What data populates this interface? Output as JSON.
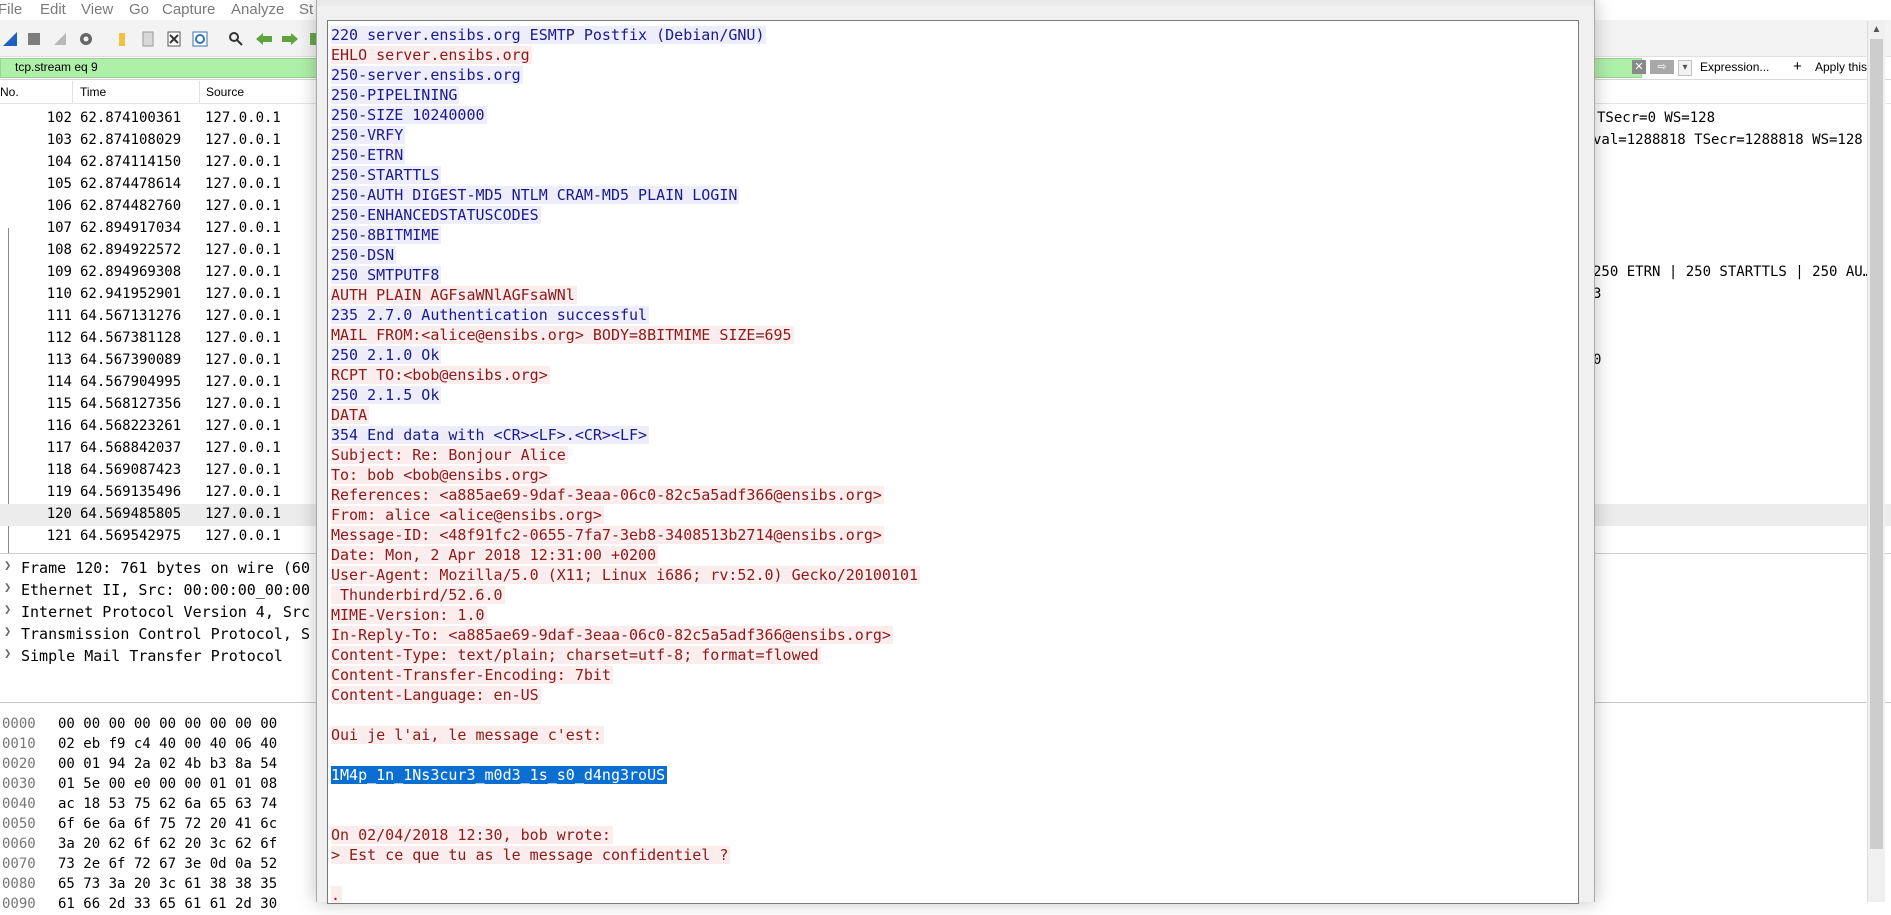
{
  "menu": [
    "File",
    "Edit",
    "View",
    "Go",
    "Capture",
    "Analyze",
    "St"
  ],
  "toolbar_icons": [
    "shark-fin-start-icon",
    "stop-icon",
    "restart-icon",
    "gear-options-icon",
    "open-folder-icon",
    "file-icon",
    "close-file-icon",
    "reload-icon",
    "find-icon",
    "back-arrow-icon",
    "forward-arrow-icon",
    "jump-icon"
  ],
  "filter": {
    "value": "tcp.stream eq 9",
    "expression_label": "Expression...",
    "apply_plus": "+",
    "apply_label": "Apply this filt"
  },
  "columns": [
    "No.",
    "Time",
    "Source"
  ],
  "packets": [
    {
      "no": "102",
      "time": "62.874100361",
      "source": "127.0.0.1"
    },
    {
      "no": "103",
      "time": "62.874108029",
      "source": "127.0.0.1"
    },
    {
      "no": "104",
      "time": "62.874114150",
      "source": "127.0.0.1"
    },
    {
      "no": "105",
      "time": "62.874478614",
      "source": "127.0.0.1"
    },
    {
      "no": "106",
      "time": "62.874482760",
      "source": "127.0.0.1"
    },
    {
      "no": "107",
      "time": "62.894917034",
      "source": "127.0.0.1"
    },
    {
      "no": "108",
      "time": "62.894922572",
      "source": "127.0.0.1"
    },
    {
      "no": "109",
      "time": "62.894969308",
      "source": "127.0.0.1"
    },
    {
      "no": "110",
      "time": "62.941952901",
      "source": "127.0.0.1"
    },
    {
      "no": "111",
      "time": "64.567131276",
      "source": "127.0.0.1"
    },
    {
      "no": "112",
      "time": "64.567381128",
      "source": "127.0.0.1"
    },
    {
      "no": "113",
      "time": "64.567390089",
      "source": "127.0.0.1"
    },
    {
      "no": "114",
      "time": "64.567904995",
      "source": "127.0.0.1"
    },
    {
      "no": "115",
      "time": "64.568127356",
      "source": "127.0.0.1"
    },
    {
      "no": "116",
      "time": "64.568223261",
      "source": "127.0.0.1"
    },
    {
      "no": "117",
      "time": "64.568842037",
      "source": "127.0.0.1"
    },
    {
      "no": "118",
      "time": "64.569087423",
      "source": "127.0.0.1"
    },
    {
      "no": "119",
      "time": "64.569135496",
      "source": "127.0.0.1"
    },
    {
      "no": "120",
      "time": "64.569485805",
      "source": "127.0.0.1",
      "selected": true
    },
    {
      "no": "121",
      "time": "64.569542975",
      "source": "127.0.0.1"
    }
  ],
  "info_fragments": {
    "row102": "TSecr=0 WS=128",
    "row103": "val=1288818 TSecr=1288818 WS=128",
    "row109": "250 ETRN | 250 STARTTLS | 250 AU…",
    "row110": "3",
    "row113": "0"
  },
  "details": [
    "Frame 120: 761 bytes on wire (60",
    "Ethernet II, Src: 00:00:00_00:00",
    "Internet Protocol Version 4, Src",
    "Transmission Control Protocol, S",
    "Simple Mail Transfer Protocol"
  ],
  "hex_rows": [
    {
      "offset": "0000",
      "bytes": "00 00 00 00 00 00 00 00  00"
    },
    {
      "offset": "0010",
      "bytes": "02 eb f9 c4 40 00 40 06  40"
    },
    {
      "offset": "0020",
      "bytes": "00 01 94 2a 02 4b b3 8a  54"
    },
    {
      "offset": "0030",
      "bytes": "01 5e 00 e0 00 00 01 01  08"
    },
    {
      "offset": "0040",
      "bytes": "ac 18 53 75 62 6a 65 63  74"
    },
    {
      "offset": "0050",
      "bytes": "6f 6e 6a 6f 75 72 20 41  6c"
    },
    {
      "offset": "0060",
      "bytes": "3a 20 62 6f 62 20 3c 62  6f"
    },
    {
      "offset": "0070",
      "bytes": "73 2e 6f 72 67 3e 0d 0a  52"
    },
    {
      "offset": "0080",
      "bytes": "65 73 3a 20 3c 61 38 38  35"
    },
    {
      "offset": "0090",
      "bytes": "61 66 2d 33 65 61 61 2d  30"
    }
  ],
  "stream": [
    {
      "type": "server",
      "text": "220 server.ensibs.org ESMTP Postfix (Debian/GNU)"
    },
    {
      "type": "client",
      "text": "EHLO server.ensibs.org"
    },
    {
      "type": "server",
      "text": "250-server.ensibs.org"
    },
    {
      "type": "server",
      "text": "250-PIPELINING"
    },
    {
      "type": "server",
      "text": "250-SIZE 10240000"
    },
    {
      "type": "server",
      "text": "250-VRFY"
    },
    {
      "type": "server",
      "text": "250-ETRN"
    },
    {
      "type": "server",
      "text": "250-STARTTLS"
    },
    {
      "type": "server",
      "text": "250-AUTH DIGEST-MD5 NTLM CRAM-MD5 PLAIN LOGIN"
    },
    {
      "type": "server",
      "text": "250-ENHANCEDSTATUSCODES"
    },
    {
      "type": "server",
      "text": "250-8BITMIME"
    },
    {
      "type": "server",
      "text": "250-DSN"
    },
    {
      "type": "server",
      "text": "250 SMTPUTF8"
    },
    {
      "type": "client",
      "text": "AUTH PLAIN AGFsaWNlAGFsaWNl"
    },
    {
      "type": "server",
      "text": "235 2.7.0 Authentication successful"
    },
    {
      "type": "client",
      "text": "MAIL FROM:<alice@ensibs.org> BODY=8BITMIME SIZE=695"
    },
    {
      "type": "server",
      "text": "250 2.1.0 Ok"
    },
    {
      "type": "client",
      "text": "RCPT TO:<bob@ensibs.org>"
    },
    {
      "type": "server",
      "text": "250 2.1.5 Ok"
    },
    {
      "type": "client",
      "text": "DATA"
    },
    {
      "type": "server",
      "text": "354 End data with <CR><LF>.<CR><LF>"
    },
    {
      "type": "client",
      "text": "Subject: Re: Bonjour Alice"
    },
    {
      "type": "client",
      "text": "To: bob <bob@ensibs.org>"
    },
    {
      "type": "client",
      "text": "References: <a885ae69-9daf-3eaa-06c0-82c5a5adf366@ensibs.org>"
    },
    {
      "type": "client",
      "text": "From: alice <alice@ensibs.org>"
    },
    {
      "type": "client",
      "text": "Message-ID: <48f91fc2-0655-7fa7-3eb8-3408513b2714@ensibs.org>"
    },
    {
      "type": "client",
      "text": "Date: Mon, 2 Apr 2018 12:31:00 +0200"
    },
    {
      "type": "client",
      "text": "User-Agent: Mozilla/5.0 (X11; Linux i686; rv:52.0) Gecko/20100101"
    },
    {
      "type": "client",
      "text": " Thunderbird/52.6.0"
    },
    {
      "type": "client",
      "text": "MIME-Version: 1.0"
    },
    {
      "type": "client",
      "text": "In-Reply-To: <a885ae69-9daf-3eaa-06c0-82c5a5adf366@ensibs.org>"
    },
    {
      "type": "client",
      "text": "Content-Type: text/plain; charset=utf-8; format=flowed"
    },
    {
      "type": "client",
      "text": "Content-Transfer-Encoding: 7bit"
    },
    {
      "type": "client",
      "text": "Content-Language: en-US"
    },
    {
      "type": "blank",
      "text": ""
    },
    {
      "type": "client",
      "text": "Oui je l'ai, le message c'est:"
    },
    {
      "type": "blank",
      "text": ""
    },
    {
      "type": "highlight",
      "text": "1M4p_1n_1Ns3cur3_m0d3_1s_s0_d4ng3roUS"
    },
    {
      "type": "blank",
      "text": ""
    },
    {
      "type": "blank",
      "text": ""
    },
    {
      "type": "client",
      "text": "On 02/04/2018 12:30, bob wrote:"
    },
    {
      "type": "client",
      "text": "> Est ce que tu as le message confidentiel ?"
    },
    {
      "type": "blank",
      "text": ""
    },
    {
      "type": "client",
      "text": "."
    }
  ],
  "colors": {
    "filter_valid": "#aff0a9",
    "server_bg": "#ededfb",
    "server_fg": "#1a1a8c",
    "client_bg": "#fbeded",
    "client_fg": "#8c1a1a",
    "selection": "#0a6fd1"
  }
}
